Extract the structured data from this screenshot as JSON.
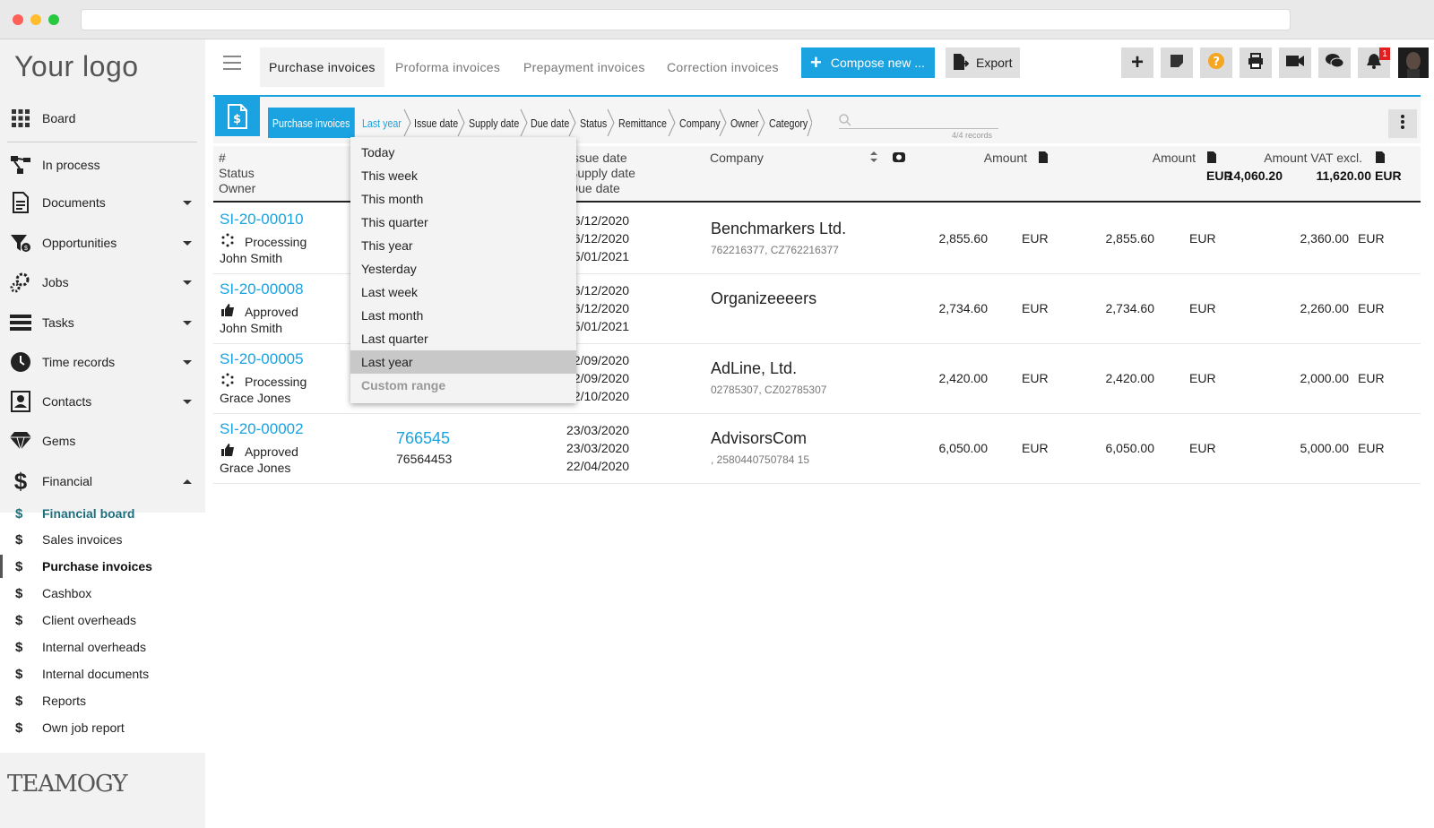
{
  "brand": {
    "logo": "Your logo",
    "footer_logo": "TEAMOGY"
  },
  "sidebar": {
    "items": [
      {
        "label": "Board",
        "icon": "grid-icon"
      },
      {
        "label": "In process",
        "icon": "workflow-icon"
      },
      {
        "label": "Documents",
        "icon": "document-icon"
      },
      {
        "label": "Opportunities",
        "icon": "funnel-icon"
      },
      {
        "label": "Jobs",
        "icon": "gears-icon"
      },
      {
        "label": "Tasks",
        "icon": "tasks-icon"
      },
      {
        "label": "Time records",
        "icon": "clock-icon"
      },
      {
        "label": "Contacts",
        "icon": "contact-icon"
      },
      {
        "label": "Gems",
        "icon": "gem-icon"
      },
      {
        "label": "Financial",
        "icon": "dollar-icon"
      }
    ],
    "financial_sub": [
      {
        "label": "Financial board"
      },
      {
        "label": "Sales invoices"
      },
      {
        "label": "Purchase invoices"
      },
      {
        "label": "Cashbox"
      },
      {
        "label": "Client overheads"
      },
      {
        "label": "Internal overheads"
      },
      {
        "label": "Internal documents"
      },
      {
        "label": "Reports"
      },
      {
        "label": "Own job report"
      }
    ],
    "dollar": "$"
  },
  "tabs": [
    "Purchase invoices",
    "Proforma invoices",
    "Prepayment invoices",
    "Correction invoices"
  ],
  "toolbar": {
    "compose": "Compose new ...",
    "export": "Export",
    "notifications_count": "1"
  },
  "filters": {
    "crumbs": [
      "Purchase invoices",
      "Last year",
      "Issue date",
      "Supply date",
      "Due date",
      "Status",
      "Remittance",
      "Company",
      "Owner",
      "Category"
    ],
    "records": "4/4 records"
  },
  "table": {
    "headers": {
      "col1": [
        "#",
        "Status",
        "Owner"
      ],
      "dates": [
        "Issue date",
        "Supply date",
        "Due date"
      ],
      "company": "Company",
      "amount": "Amount",
      "amount_total": "14,060.20",
      "amount_vat": "Amount VAT excl.",
      "amount_vat_total": "11,620.00",
      "currency": "EUR"
    },
    "rows": [
      {
        "id": "SI-20-00010",
        "status": "Processing",
        "owner": "John Smith",
        "num1": "",
        "num2": "",
        "d1": "16/12/2020",
        "d2": "16/12/2020",
        "d3": "15/01/2021",
        "company": "Benchmarkers Ltd.",
        "company_id": "762216377, CZ762216377",
        "a1": "2,855.60",
        "a2": "2,855.60",
        "a3": "2,360.00"
      },
      {
        "id": "SI-20-00008",
        "status": "Approved",
        "owner": "John Smith",
        "num1": "",
        "num2": "",
        "d1": "16/12/2020",
        "d2": "16/12/2020",
        "d3": "15/01/2021",
        "company": "Organizeeeers",
        "company_id": "",
        "a1": "2,734.60",
        "a2": "2,734.60",
        "a3": "2,260.00"
      },
      {
        "id": "SI-20-00005",
        "status": "Processing",
        "owner": "Grace Jones",
        "num1": "",
        "num2": "",
        "d1": "22/09/2020",
        "d2": "22/09/2020",
        "d3": "22/10/2020",
        "company": "AdLine, Ltd.",
        "company_id": "02785307, CZ02785307",
        "a1": "2,420.00",
        "a2": "2,420.00",
        "a3": "2,000.00"
      },
      {
        "id": "SI-20-00002",
        "status": "Approved",
        "owner": "Grace Jones",
        "num1": "766545",
        "num2": "76564453",
        "d1": "23/03/2020",
        "d2": "23/03/2020",
        "d3": "22/04/2020",
        "company": "AdvisorsCom",
        "company_id": ", 2580440750784 15",
        "a1": "6,050.00",
        "a2": "6,050.00",
        "a3": "5,000.00"
      }
    ]
  },
  "dropdown": {
    "options": [
      "Today",
      "This week",
      "This month",
      "This quarter",
      "This year",
      "Yesterday",
      "Last week",
      "Last month",
      "Last quarter",
      "Last year",
      "Custom range"
    ],
    "selected": "Last year"
  },
  "colors": {
    "accent": "#1aa3e0",
    "financial_active": "#1e6f7e"
  }
}
